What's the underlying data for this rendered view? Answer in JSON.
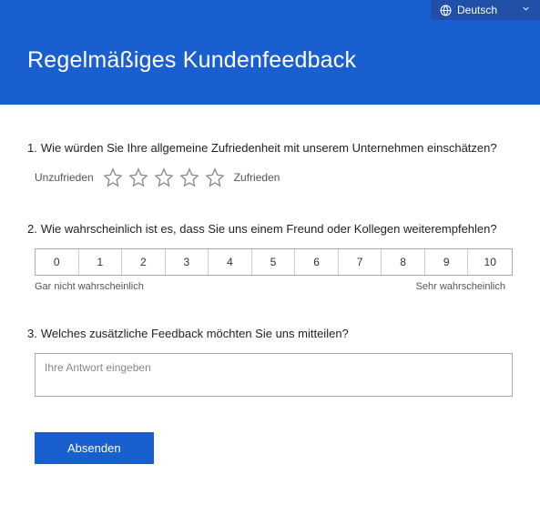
{
  "language": {
    "current": "Deutsch"
  },
  "header": {
    "title": "Regelmäßiges Kundenfeedback"
  },
  "questions": {
    "q1": {
      "num": "1.",
      "text": "Wie würden Sie Ihre allgemeine Zufriedenheit mit unserem Unternehmen einschätzen?",
      "low_label": "Unzufrieden",
      "high_label": "Zufrieden"
    },
    "q2": {
      "num": "2.",
      "text": "Wie wahrscheinlich ist es, dass Sie uns einem Freund oder Kollegen weiterempfehlen?",
      "options": [
        "0",
        "1",
        "2",
        "3",
        "4",
        "5",
        "6",
        "7",
        "8",
        "9",
        "10"
      ],
      "low_label": "Gar nicht wahrscheinlich",
      "high_label": "Sehr wahrscheinlich"
    },
    "q3": {
      "num": "3.",
      "text": "Welches zusätzliche Feedback möchten Sie uns mitteilen?",
      "placeholder": "Ihre Antwort eingeben"
    }
  },
  "submit_label": "Absenden"
}
